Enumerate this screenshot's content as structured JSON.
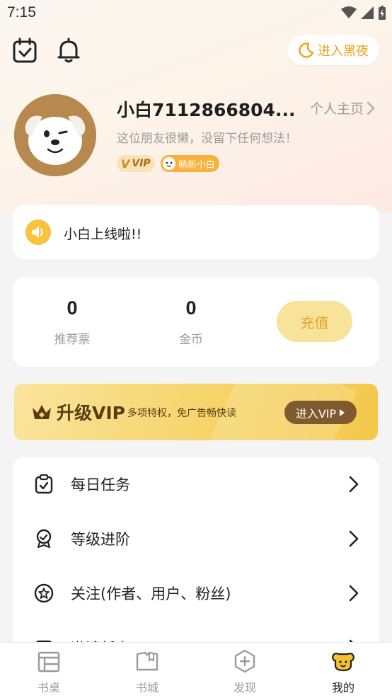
{
  "status_bar": {
    "time": "7:15"
  },
  "header": {
    "night_mode_label": "进入黑夜"
  },
  "profile": {
    "username": "小白7112866804...",
    "homepage_label": "个人主页",
    "signature": "这位朋友很懒，没留下任何想法！",
    "vip_badge": "VIP",
    "level_badge": "萌新小白"
  },
  "notice": {
    "text": "小白上线啦!!"
  },
  "stats": {
    "items": [
      {
        "value": "0",
        "label": "推荐票"
      },
      {
        "value": "0",
        "label": "金币"
      }
    ],
    "recharge_label": "充值"
  },
  "vip_banner": {
    "title": "升级VIP",
    "desc": "多项特权，免广告畅快读",
    "button": "进入VIP"
  },
  "menu": {
    "items": [
      {
        "label": "每日任务",
        "icon": "task-clipboard-icon"
      },
      {
        "label": "等级进阶",
        "icon": "level-medal-icon"
      },
      {
        "label": "关注(作者、用户、粉丝)",
        "icon": "star-circle-icon"
      },
      {
        "label": "邀请新人",
        "icon": "invite-icon"
      }
    ]
  },
  "tabbar": {
    "tabs": [
      {
        "label": "书桌",
        "icon": "bookshelf-icon"
      },
      {
        "label": "书城",
        "icon": "book-store-icon"
      },
      {
        "label": "发现",
        "icon": "discover-icon"
      },
      {
        "label": "我的",
        "icon": "dog-profile-icon"
      }
    ],
    "active_index": 3
  },
  "colors": {
    "accent": "#f0a21a",
    "vip_banner": "#f6d469",
    "text_primary": "#222222",
    "text_secondary": "#9a9a9a"
  }
}
